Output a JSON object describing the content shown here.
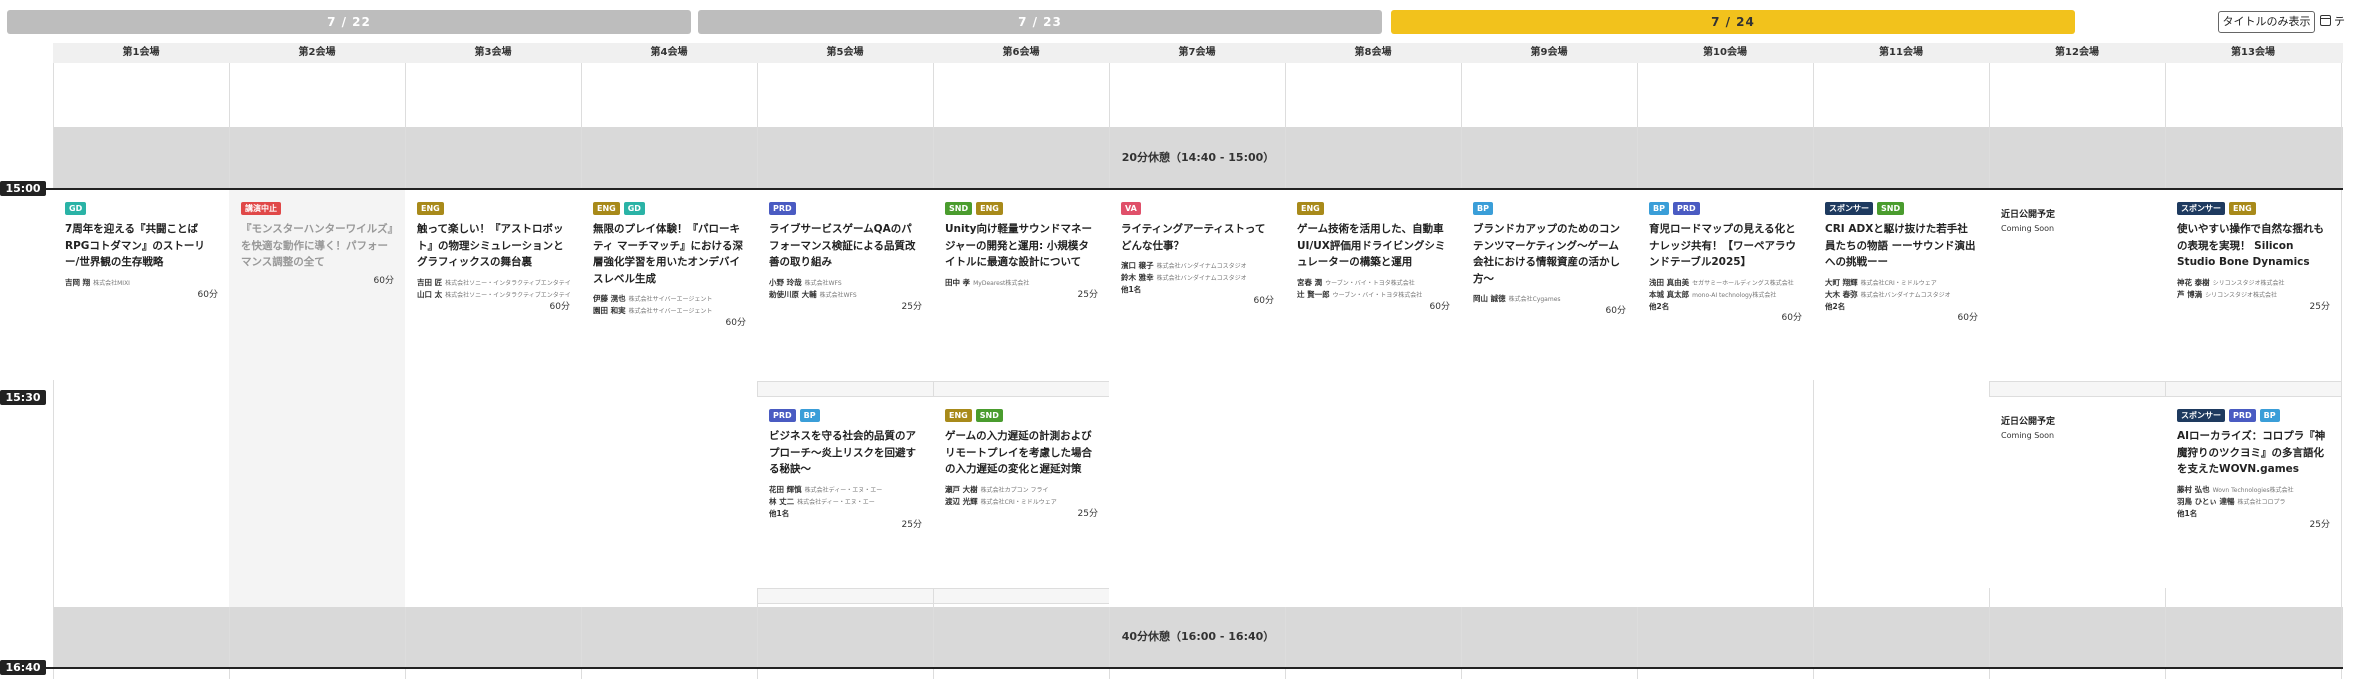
{
  "dates": [
    {
      "label": "7 / 22",
      "active": false
    },
    {
      "label": "7 / 23",
      "active": false
    },
    {
      "label": "7 / 24",
      "active": true
    }
  ],
  "controls": {
    "title_only": "タイトルのみ表示",
    "calendar_label": "テ"
  },
  "halls": [
    "第1会場",
    "第2会場",
    "第3会場",
    "第4会場",
    "第5会場",
    "第6会場",
    "第7会場",
    "第8会場",
    "第9会場",
    "第10会場",
    "第11会場",
    "第12会場",
    "第13会場"
  ],
  "breaks": {
    "first": "20分休憩（14:40 - 15:00）",
    "second": "40分休憩（16:00 - 16:40）"
  },
  "times": {
    "t1": "15:00",
    "t2": "15:30",
    "t3": "16:40"
  },
  "tag_colors": {
    "GD": "#2ab3a6",
    "講演中止": "#e04848",
    "ENG": "#a88a1a",
    "PRD": "#4a5bc2",
    "SND": "#4a9c2e",
    "VA": "#e0506a",
    "BP": "#3a9ed8",
    "スポンサー": "#1e3a5f"
  },
  "sessions": {
    "s1": {
      "tags": [
        "GD"
      ],
      "title": "7周年を迎える『共闘ことばRPGコトダマン』のストーリー/世界観の生存戦略",
      "speakers": [
        {
          "name": "吉岡 翔",
          "org": "株式会社MIXI"
        }
      ],
      "duration": "60分"
    },
    "s2": {
      "tags": [
        "講演中止"
      ],
      "title": "『モンスターハンターワイルズ』を快適な動作に導く！パフォーマンス調整の全て",
      "duration": "60分"
    },
    "s3": {
      "tags": [
        "ENG"
      ],
      "title": "触って楽しい！『アストロボット』の物理シミュレーションとグラフィックスの舞台裏",
      "speakers": [
        {
          "name": "吉田 匠",
          "org": "株式会社ソニー・インタラクティブエンタテインメント"
        },
        {
          "name": "山口 太",
          "org": "株式会社ソニー・インタラクティブエンタテインメント"
        }
      ],
      "duration": "60分"
    },
    "s4": {
      "tags": [
        "ENG",
        "GD"
      ],
      "title": "無限のプレイ体験！『パローキティ マーチマッチ』における深層強化学習を用いたオンデバイスレベル生成",
      "speakers": [
        {
          "name": "伊藤 滉也",
          "org": "株式会社サイバーエージェント"
        },
        {
          "name": "園田 和実",
          "org": "株式会社サイバーエージェント"
        }
      ],
      "duration": "60分"
    },
    "s5": {
      "tags": [
        "PRD"
      ],
      "title": "ライブサービスゲームQAのパフォーマンス検証による品質改善の取り組み",
      "speakers": [
        {
          "name": "小野 玲哉",
          "org": "株式会社WFS"
        },
        {
          "name": "勅使川原 大輔",
          "org": "株式会社WFS"
        }
      ],
      "duration": "25分"
    },
    "s6": {
      "tags": [
        "SND",
        "ENG"
      ],
      "title": "Unity向け軽量サウンドマネージャーの開発と運用: 小規模タイトルに最適な設計について",
      "speakers": [
        {
          "name": "田中 孝",
          "org": "MyDearest株式会社"
        }
      ],
      "duration": "25分"
    },
    "s7": {
      "tags": [
        "VA"
      ],
      "title": "ライティングアーティストってどんな仕事？",
      "speakers": [
        {
          "name": "濱口 穣子",
          "org": "株式会社バンダイナムコスタジオ"
        },
        {
          "name": "鈴木 雅幸",
          "org": "株式会社バンダイナムコスタジオ"
        }
      ],
      "more": "他1名",
      "duration": "60分"
    },
    "s8": {
      "tags": [
        "ENG"
      ],
      "title": "ゲーム技術を活用した、自動車UI/UX評価用ドライビングシミュレーターの構築と運用",
      "speakers": [
        {
          "name": "宮春 潤",
          "org": "ウーブン・バイ・トヨタ株式会社"
        },
        {
          "name": "辻 賢一郎",
          "org": "ウーブン・バイ・トヨタ株式会社"
        }
      ],
      "duration": "60分"
    },
    "s9": {
      "tags": [
        "BP"
      ],
      "title": "ブランドカアップのためのコンテンツマーケティング〜ゲーム会社における情報資産の活かし方〜",
      "speakers": [
        {
          "name": "岡山 誠徳",
          "org": "株式会社Cygames"
        }
      ],
      "duration": "60分"
    },
    "s10": {
      "tags": [
        "BP",
        "PRD"
      ],
      "title": "育児ロードマップの見える化とナレッジ共有！【ワーペアラウンドテーブル2025】",
      "speakers": [
        {
          "name": "浅田 真由美",
          "org": "セガサミーホールディングス株式会社"
        },
        {
          "name": "本城 真太郎",
          "org": "mono-AI technology株式会社"
        }
      ],
      "more": "他2名",
      "duration": "60分"
    },
    "s11": {
      "tags": [
        "スポンサー",
        "SND"
      ],
      "title": "CRI ADXと駆け抜けた若手社員たちの物語 ーーサウンド演出への挑戦ーー",
      "speakers": [
        {
          "name": "大町 翔輝",
          "org": "株式会社CRI・ミドルウェア"
        },
        {
          "name": "大木 春弥",
          "org": "株式会社バンダイナムコスタジオ"
        }
      ],
      "more": "他2名",
      "duration": "60分"
    },
    "s12": {
      "coming_jp": "近日公開予定",
      "coming_en": "Coming Soon"
    },
    "s13": {
      "tags": [
        "スポンサー",
        "ENG"
      ],
      "title": "使いやすい操作で自然な揺れもの表現を実現！ Silicon Studio Bone Dynamics",
      "speakers": [
        {
          "name": "神花 泰樹",
          "org": "シリコンスタジオ株式会社"
        },
        {
          "name": "芦 博満",
          "org": "シリコンスタジオ株式会社"
        }
      ],
      "duration": "25分"
    },
    "s14": {
      "tags": [
        "PRD",
        "BP"
      ],
      "title": "ビジネスを守る社会的品質のアプローチ〜炎上リスクを回避する秘訣〜",
      "speakers": [
        {
          "name": "花田 輝慎",
          "org": "株式会社ディー・エヌ・エー"
        },
        {
          "name": "林 丈二",
          "org": "株式会社ディー・エヌ・エー"
        }
      ],
      "more": "他1名",
      "duration": "25分"
    },
    "s15": {
      "tags": [
        "ENG",
        "SND"
      ],
      "title": "ゲームの入力遅延の計測およびリモートプレイを考慮した場合の入力遅延の変化と遅延対策",
      "speakers": [
        {
          "name": "瀬戸 大樹",
          "org": "株式会社カプコン フライ"
        },
        {
          "name": "渡辺 光輝",
          "org": "株式会社CRI・ミドルウェア"
        }
      ],
      "duration": "25分"
    },
    "s16": {
      "coming_jp": "近日公開予定",
      "coming_en": "Coming Soon"
    },
    "s17": {
      "tags": [
        "スポンサー",
        "PRD",
        "BP"
      ],
      "title": "AIローカライズ：コロプラ『神魔狩りのツクヨミ』の多言語化を支えたWOVN.games",
      "speakers": [
        {
          "name": "藤村 弘也",
          "org": "Wovn Technologies株式会社"
        },
        {
          "name": "羽鳥 ひとぃ 達暢",
          "org": "株式会社コロプラ"
        }
      ],
      "more": "他1名",
      "duration": "25分"
    }
  }
}
